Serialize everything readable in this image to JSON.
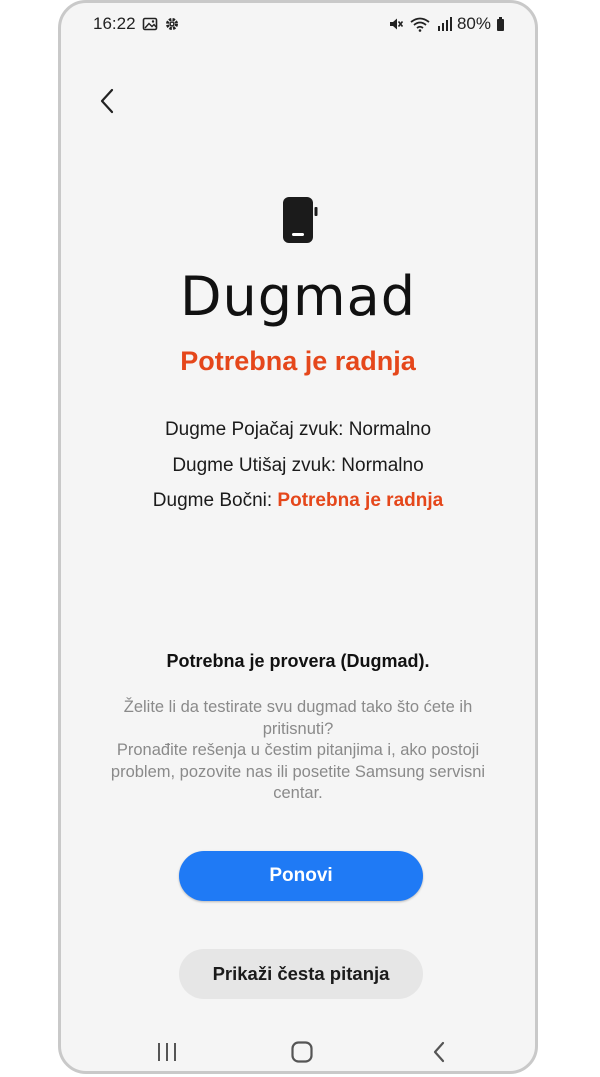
{
  "status_bar": {
    "time": "16:22",
    "left_icons": [
      "image-icon",
      "settings-gear-icon"
    ],
    "right_icons": [
      "mute-icon",
      "wifi-icon",
      "signal-icon",
      "battery-icon"
    ],
    "battery": "80%"
  },
  "header": {
    "back_icon": "chevron-left-icon"
  },
  "main": {
    "device_icon": "phone-side-button-icon",
    "title": "Dugmad",
    "status": "Potrebna je radnja",
    "results": [
      {
        "label": "Dugme Pojačaj zvuk:",
        "value": "Normalno"
      },
      {
        "label": "Dugme Utišaj zvuk:",
        "value": "Normalno"
      },
      {
        "label": "Dugme Bočni:",
        "value": "Potrebna je radnja"
      }
    ],
    "check_title": "Potrebna je provera (Dugmad).",
    "description_1": "Želite li da testirate svu dugmad tako što ćete ih pritisnuti?",
    "description_2": "Pronađite rešenja u čestim pitanjima i, ako postoji problem, pozovite nas ili posetite Samsung servisni centar."
  },
  "actions": {
    "retry_label": "Ponovi",
    "faq_label": "Prikaži česta pitanja"
  },
  "navigation_bar": [
    "recent-apps-icon",
    "home-icon",
    "back-icon"
  ],
  "colors": {
    "accent_blue": "#1f7af5",
    "warning_red": "#e5471b",
    "background": "#f5f5f5"
  }
}
